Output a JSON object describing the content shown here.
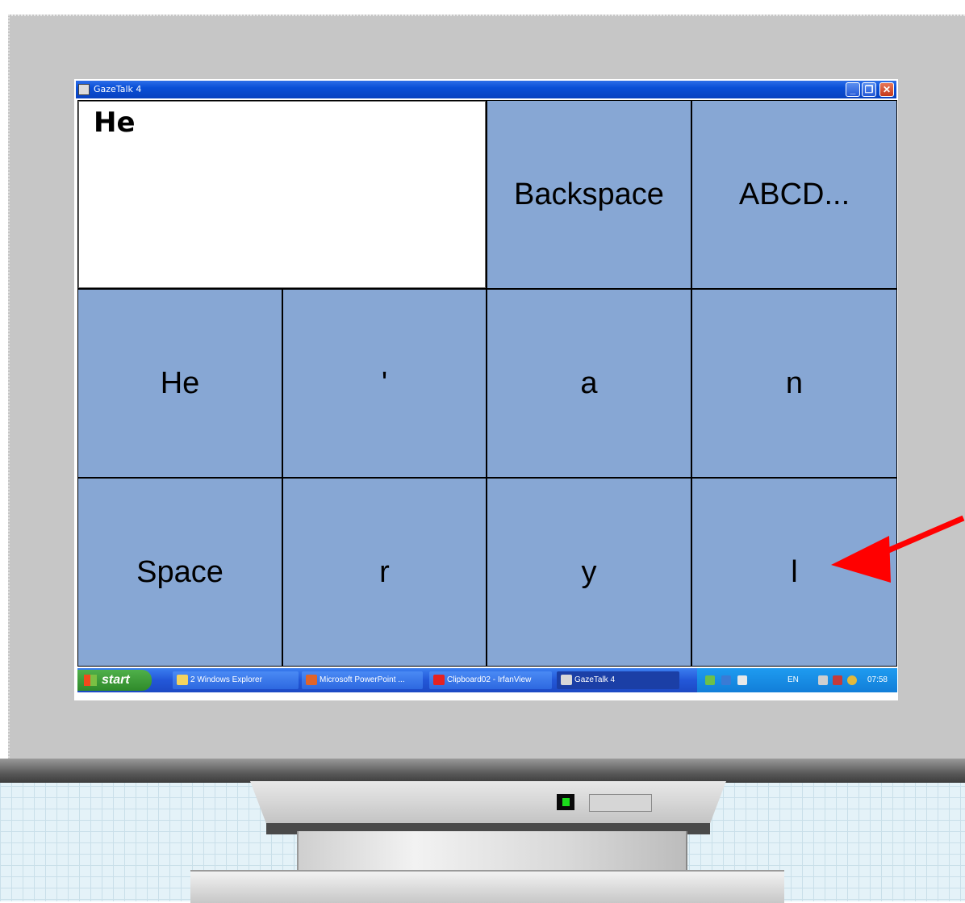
{
  "window": {
    "title": "GazeTalk 4"
  },
  "text_field": {
    "value": "He"
  },
  "keys": {
    "backspace": "Backspace",
    "abcd": "ABCD...",
    "word_he": "He",
    "apostrophe": "'",
    "a": "a",
    "n": "n",
    "space": "Space",
    "r": "r",
    "y": "y",
    "l": "l"
  },
  "taskbar": {
    "start": "start",
    "tasks": [
      {
        "label": "2 Windows Explorer",
        "icon": "folder-icon"
      },
      {
        "label": "Microsoft PowerPoint ...",
        "icon": "powerpoint-icon"
      },
      {
        "label": "Clipboard02 - IrfanView",
        "icon": "irfanview-icon"
      },
      {
        "label": "GazeTalk 4",
        "icon": "gazetalk-icon"
      }
    ],
    "language": "EN",
    "clock": "07:58"
  },
  "colors": {
    "key_fill": "#87a7d4",
    "titlebar": "#0a4fd6",
    "arrow": "#ff0000"
  }
}
